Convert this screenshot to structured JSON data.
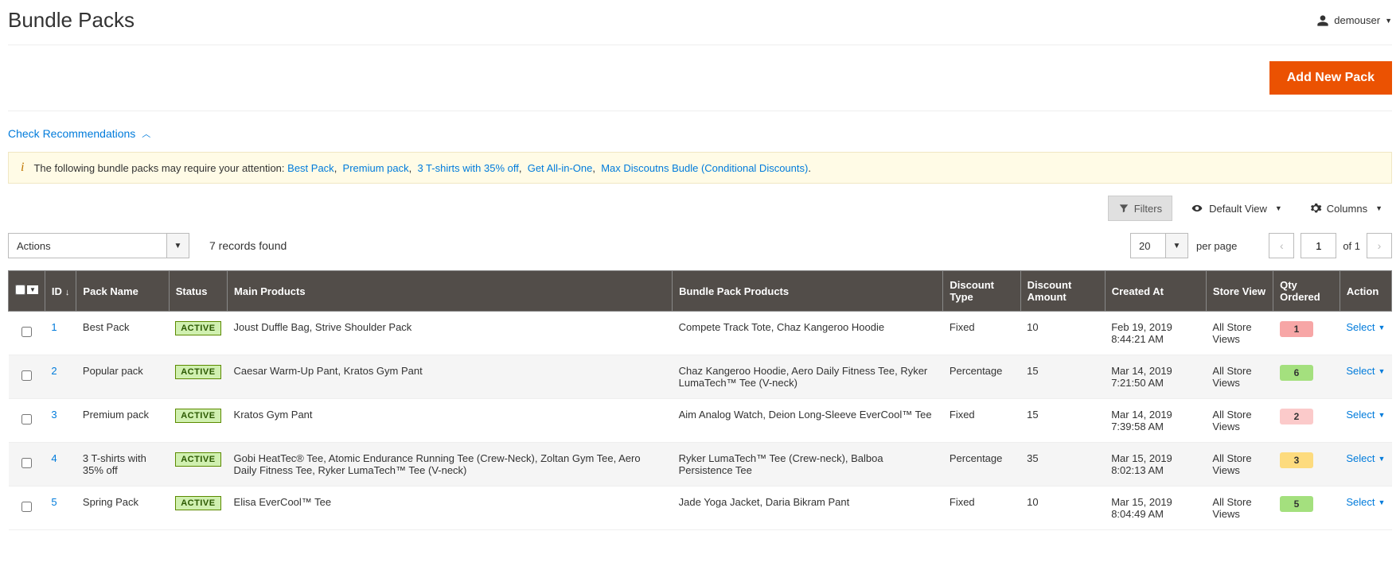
{
  "header": {
    "title": "Bundle Packs",
    "username": "demouser"
  },
  "primaryButton": "Add New Pack",
  "recommendLink": "Check Recommendations",
  "notice": {
    "prefix": "The following bundle packs may require your attention:",
    "links": [
      "Best Pack",
      "Premium pack",
      "3 T-shirts with 35% off",
      "Get All-in-One",
      "Max Discoutns Budle (Conditional Discounts)"
    ]
  },
  "controls": {
    "filters": "Filters",
    "defaultView": "Default View",
    "columns": "Columns"
  },
  "actionsLabel": "Actions",
  "recordsFound": "7 records found",
  "pageSize": "20",
  "perPage": "per page",
  "currentPage": "1",
  "totalPages": "of 1",
  "columns": {
    "id": "ID",
    "packName": "Pack Name",
    "status": "Status",
    "mainProducts": "Main Products",
    "bundleProducts": "Bundle Pack Products",
    "discountType": "Discount Type",
    "discountAmount": "Discount Amount",
    "createdAt": "Created At",
    "storeView": "Store View",
    "qtyOrdered": "Qty Ordered",
    "action": "Action"
  },
  "rows": [
    {
      "id": "1",
      "packName": "Best Pack",
      "status": "ACTIVE",
      "mainProducts": "Joust Duffle Bag, Strive Shoulder Pack",
      "bundleProducts": "Compete Track Tote, Chaz Kangeroo Hoodie",
      "discountType": "Fixed",
      "discountAmount": "10",
      "createdAt": "Feb 19, 2019 8:44:21 AM",
      "storeView": "All Store Views",
      "qtyOrdered": "1",
      "qtyColor": "qty-red",
      "action": "Select"
    },
    {
      "id": "2",
      "packName": "Popular pack",
      "status": "ACTIVE",
      "mainProducts": "Caesar Warm-Up Pant, Kratos Gym Pant",
      "bundleProducts": "Chaz Kangeroo Hoodie, Aero Daily Fitness Tee, Ryker LumaTech&trade; Tee (V-neck)",
      "discountType": "Percentage",
      "discountAmount": "15",
      "createdAt": "Mar 14, 2019 7:21:50 AM",
      "storeView": "All Store Views",
      "qtyOrdered": "6",
      "qtyColor": "qty-green",
      "action": "Select"
    },
    {
      "id": "3",
      "packName": "Premium pack",
      "status": "ACTIVE",
      "mainProducts": "Kratos Gym Pant",
      "bundleProducts": "Aim Analog Watch, Deion Long-Sleeve EverCool&trade; Tee",
      "discountType": "Fixed",
      "discountAmount": "15",
      "createdAt": "Mar 14, 2019 7:39:58 AM",
      "storeView": "All Store Views",
      "qtyOrdered": "2",
      "qtyColor": "qty-pink",
      "action": "Select"
    },
    {
      "id": "4",
      "packName": "3 T-shirts with 35% off",
      "status": "ACTIVE",
      "mainProducts": "Gobi HeatTec&reg; Tee, Atomic Endurance Running Tee (Crew-Neck), Zoltan Gym Tee, Aero Daily Fitness Tee, Ryker LumaTech&trade; Tee (V-neck)",
      "bundleProducts": "Ryker LumaTech&trade; Tee (Crew-neck), Balboa Persistence Tee",
      "discountType": "Percentage",
      "discountAmount": "35",
      "createdAt": "Mar 15, 2019 8:02:13 AM",
      "storeView": "All Store Views",
      "qtyOrdered": "3",
      "qtyColor": "qty-yellow",
      "action": "Select"
    },
    {
      "id": "5",
      "packName": "Spring Pack",
      "status": "ACTIVE",
      "mainProducts": "Elisa EverCool&trade; Tee",
      "bundleProducts": "Jade Yoga Jacket, Daria Bikram Pant",
      "discountType": "Fixed",
      "discountAmount": "10",
      "createdAt": "Mar 15, 2019 8:04:49 AM",
      "storeView": "All Store Views",
      "qtyOrdered": "5",
      "qtyColor": "qty-green",
      "action": "Select"
    }
  ]
}
